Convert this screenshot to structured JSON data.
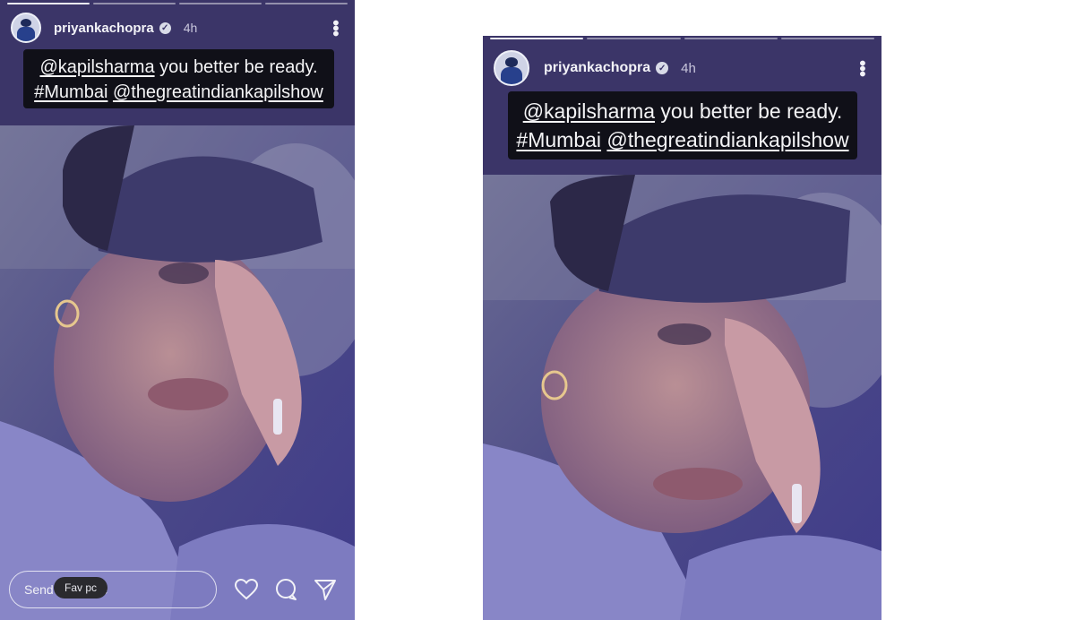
{
  "stories": [
    {
      "id": "left",
      "progress_segments": 4,
      "username": "priyankachopra",
      "verified": true,
      "time": "4h",
      "caption": {
        "line1_mention": "@kapilsharma",
        "line1_text": " you better be ready.",
        "line2_hashtag": "#Mumbai",
        "line2_mention": "@thegreatindiankapilshow"
      },
      "sticker_label": "Fav pc",
      "message_placeholder": "Send message"
    },
    {
      "id": "right",
      "progress_segments": 4,
      "username": "priyankachopra",
      "verified": true,
      "time": "4h",
      "caption": {
        "line1_mention": "@kapilsharma",
        "line1_text": " you better be ready.",
        "line2_hashtag": "#Mumbai",
        "line2_mention": "@thegreatindiankapilshow"
      }
    }
  ],
  "icons": {
    "verified": "verified-badge-icon",
    "more": "more-options-icon",
    "like": "heart-icon",
    "reply": "comment-icon",
    "share": "send-icon"
  },
  "colors": {
    "story_bg": "#3b3568",
    "caption_bg": "#101018",
    "text_light": "#f4f4f6"
  }
}
